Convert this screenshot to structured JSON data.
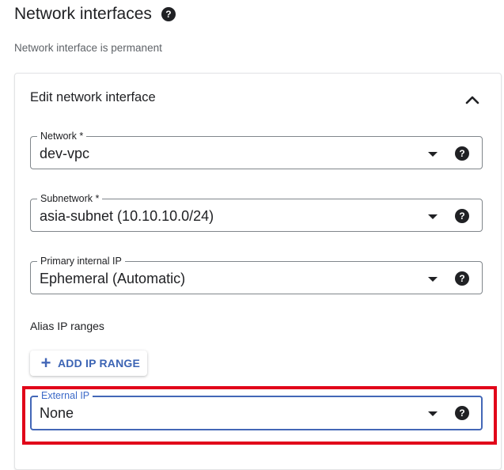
{
  "header": {
    "title": "Network interfaces",
    "subtitle": "Network interface is permanent"
  },
  "card": {
    "title": "Edit network interface",
    "collapse_icon": "chevron-up-icon"
  },
  "fields": {
    "network": {
      "label": "Network *",
      "value": "dev-vpc"
    },
    "subnetwork": {
      "label": "Subnetwork *",
      "value": "asia-subnet (10.10.10.0/24)"
    },
    "primary_ip": {
      "label": "Primary internal IP",
      "value": "Ephemeral (Automatic)"
    },
    "external_ip": {
      "label": "External IP",
      "value": "None"
    }
  },
  "alias": {
    "label": "Alias IP ranges",
    "add_button_icon": "+",
    "add_button_label": "ADD IP RANGE"
  },
  "help_icon_glyph": "?",
  "colors": {
    "accent": "#4367b7",
    "highlight": "#e1061a",
    "text": "#202124",
    "muted": "#5f6368"
  }
}
